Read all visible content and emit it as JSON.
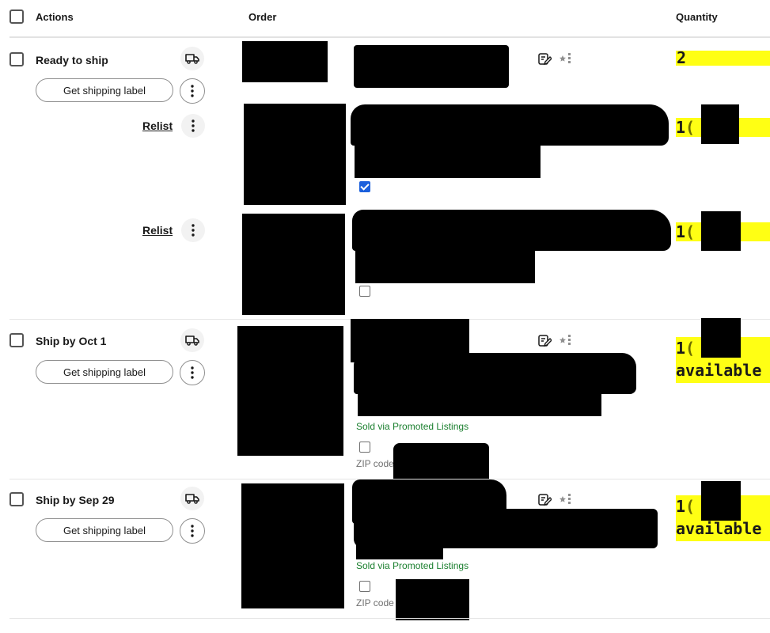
{
  "header": {
    "actions_label": "Actions",
    "order_label": "Order",
    "quantity_label": "Quantity"
  },
  "orders": [
    {
      "status": "Ready to ship",
      "shipping_button": "Get shipping label",
      "lines": [
        {
          "relist": "",
          "quantity": "2",
          "quantity_suffix": ""
        },
        {
          "relist": "Relist",
          "quantity": "1",
          "quantity_suffix": "( ava",
          "checkbox_checked": true
        },
        {
          "relist": "Relist",
          "quantity": "1",
          "quantity_suffix": "( ava",
          "checkbox_checked": false
        }
      ]
    },
    {
      "status": "Ship by Oct 1",
      "shipping_button": "Get shipping label",
      "promo": "Sold via Promoted Listings",
      "zip": "ZIP code",
      "quantity": "1",
      "quantity_suffix": "(",
      "quantity_line2": "available"
    },
    {
      "status": "Ship by Sep 29",
      "shipping_button": "Get shipping label",
      "promo": "Sold via Promoted Listings",
      "zip": "ZIP code",
      "quantity": "1",
      "quantity_suffix": "(",
      "quantity_line2": "available"
    }
  ],
  "icons": {
    "truck": "truck-icon",
    "edit_note": "edit-note-icon",
    "star_rank": "star-rank-icon",
    "more": "more-vertical-icon"
  },
  "colors": {
    "promo_green": "#1a7f2e",
    "checkbox_blue": "#1a5fdc",
    "highlight": "#ffff14"
  }
}
